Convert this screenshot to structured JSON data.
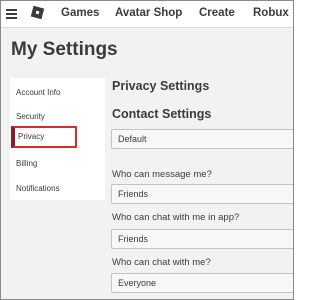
{
  "nav": {
    "links": [
      "Games",
      "Avatar Shop",
      "Create",
      "Robux"
    ]
  },
  "page": {
    "title": "My Settings"
  },
  "sidebar": {
    "items": [
      {
        "label": "Account Info",
        "active": false
      },
      {
        "label": "Security",
        "active": false
      },
      {
        "label": "Privacy",
        "active": true
      },
      {
        "label": "Billing",
        "active": false
      },
      {
        "label": "Notifications",
        "active": false
      }
    ]
  },
  "privacy": {
    "heading": "Privacy Settings",
    "contact_heading": "Contact Settings",
    "contact_value": "Default",
    "message": {
      "label": "Who can message me?",
      "value": "Friends"
    },
    "app_chat": {
      "label": "Who can chat with me in app?",
      "value": "Friends"
    },
    "chat": {
      "label": "Who can chat with me?",
      "value": "Everyone"
    }
  },
  "colors": {
    "active_border": "#d32f2f",
    "text": "#393b3d",
    "background": "#f2f2f3"
  },
  "icons": [
    "hamburger-icon",
    "roblox-logo-icon"
  ]
}
